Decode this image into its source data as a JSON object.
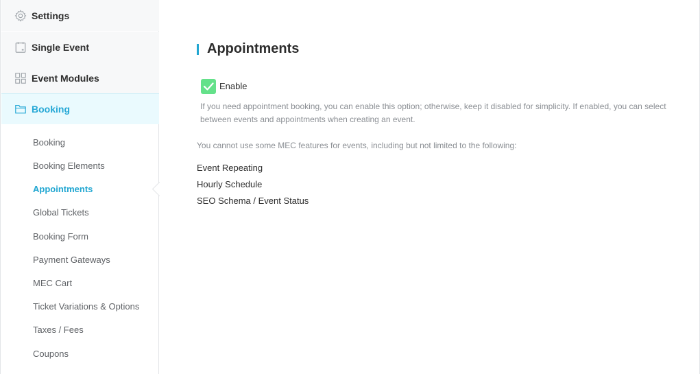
{
  "sidebar": {
    "main_items": [
      {
        "label": "Settings",
        "icon": "gear-icon"
      },
      {
        "label": "Single Event",
        "icon": "calendar-icon"
      },
      {
        "label": "Event Modules",
        "icon": "grid-icon"
      },
      {
        "label": "Booking",
        "icon": "folder-icon"
      }
    ],
    "sub_items": [
      "Booking",
      "Booking Elements",
      "Appointments",
      "Global Tickets",
      "Booking Form",
      "Payment Gateways",
      "MEC Cart",
      "Ticket Variations & Options",
      "Taxes / Fees",
      "Coupons"
    ],
    "active_main": "Booking",
    "active_sub": "Appointments"
  },
  "content": {
    "title": "Appointments",
    "enable_label": "Enable",
    "enable_checked": true,
    "help_text": "If you need appointment booking, you can enable this option; otherwise, keep it disabled for simplicity. If enabled, you can select between events and appointments when creating an event.",
    "note": "You cannot use some MEC features for events, including but not limited to the following:",
    "features": [
      "Event Repeating",
      "Hourly Schedule",
      "SEO Schema / Event Status"
    ]
  },
  "colors": {
    "accent": "#20a6d1",
    "checkbox": "#64e18a",
    "active_bg": "#eafafe"
  }
}
